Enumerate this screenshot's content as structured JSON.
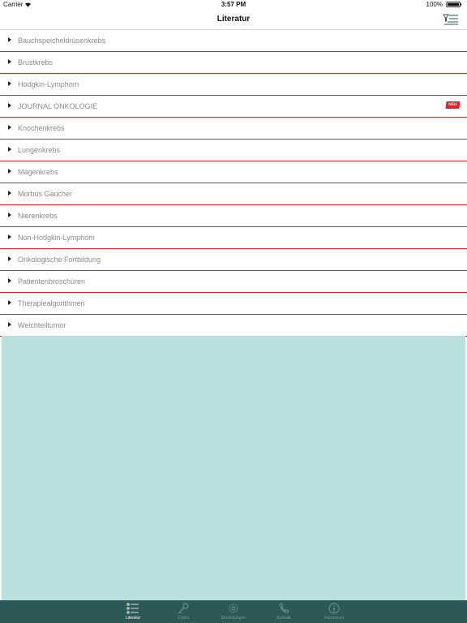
{
  "status_bar": {
    "carrier": "Carrier",
    "time": "3:57 PM",
    "battery": "100%"
  },
  "nav": {
    "title": "Literatur",
    "filter_icon": "filter-list-icon"
  },
  "list": {
    "items": [
      {
        "label": "Bauchspeicheldrüsenkrebs"
      },
      {
        "label": "Brustkrebs"
      },
      {
        "label": "Hodgkin-Lymphom"
      },
      {
        "label": "JOURNAL ONKOLOGIE",
        "badge": "NEU"
      },
      {
        "label": "Knochenkrebs"
      },
      {
        "label": "Lungenkrebs"
      },
      {
        "label": "Magenkrebs"
      },
      {
        "label": "Morbus Gaucher"
      },
      {
        "label": "Nierenkrebs"
      },
      {
        "label": "Non-Hodgkin-Lymphom"
      },
      {
        "label": "Onkologische Fortbildung"
      },
      {
        "label": "Patientenbroschüren"
      },
      {
        "label": "Therapiealgorithmen"
      },
      {
        "label": "Weichteiltumor"
      }
    ]
  },
  "tabs": [
    {
      "label": "Literatur",
      "icon": "list-icon",
      "active": true
    },
    {
      "label": "Codes",
      "icon": "key-icon",
      "active": false
    },
    {
      "label": "Einstellungen",
      "icon": "gear-icon",
      "active": false
    },
    {
      "label": "Kontakt",
      "icon": "phone-icon",
      "active": false
    },
    {
      "label": "Impressum",
      "icon": "info-icon",
      "active": false
    }
  ],
  "colors": {
    "accent_red": "#d7262d",
    "tab_bar": "#2c5957",
    "content_bg": "#b8e0df"
  }
}
